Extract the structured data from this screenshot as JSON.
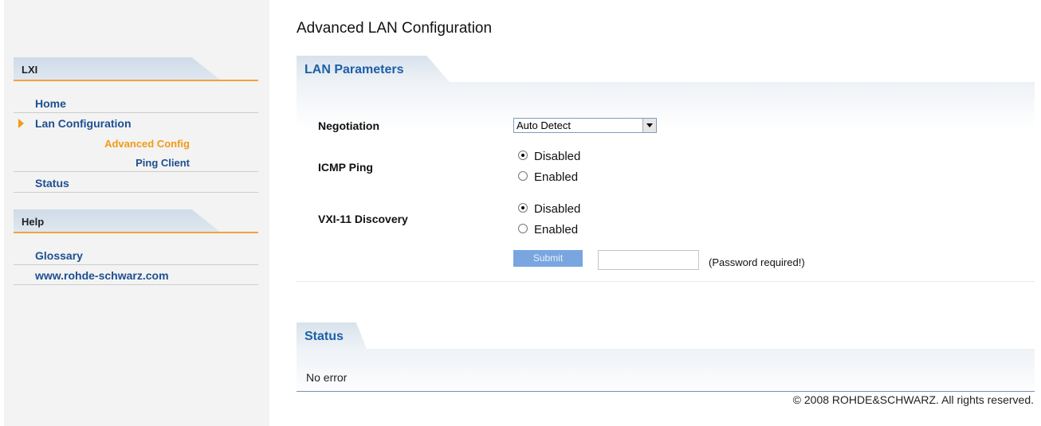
{
  "sidebar": {
    "sections": [
      {
        "title": "LXI"
      },
      {
        "title": "Help"
      }
    ],
    "lxi_items": {
      "home": "Home",
      "lan_config": "Lan Configuration",
      "advanced_config": "Advanced Config",
      "ping_client": "Ping Client",
      "status": "Status"
    },
    "help_items": {
      "glossary": "Glossary",
      "website": "www.rohde-schwarz.com"
    }
  },
  "main": {
    "title": "Advanced LAN Configuration",
    "lan_panel": {
      "tab": "LAN Parameters",
      "negotiation": {
        "label": "Negotiation",
        "value": "Auto Detect"
      },
      "icmp_ping": {
        "label": "ICMP Ping",
        "options": [
          "Disabled",
          "Enabled"
        ],
        "selected": "Disabled"
      },
      "vxi_discovery": {
        "label": "VXI-11 Discovery",
        "options": [
          "Disabled",
          "Enabled"
        ],
        "selected": "Disabled"
      },
      "submit_label": "Submit",
      "password_note": "(Password required!)"
    },
    "status_panel": {
      "tab": "Status",
      "message": "No error"
    },
    "copyright": "© 2008 ROHDE&SCHWARZ. All rights reserved."
  },
  "colors": {
    "accent_orange": "#f29a17",
    "nav_blue": "#1d4f91",
    "tab_title_blue": "#1d5fa8",
    "submit_blue": "#7aa6e0"
  }
}
